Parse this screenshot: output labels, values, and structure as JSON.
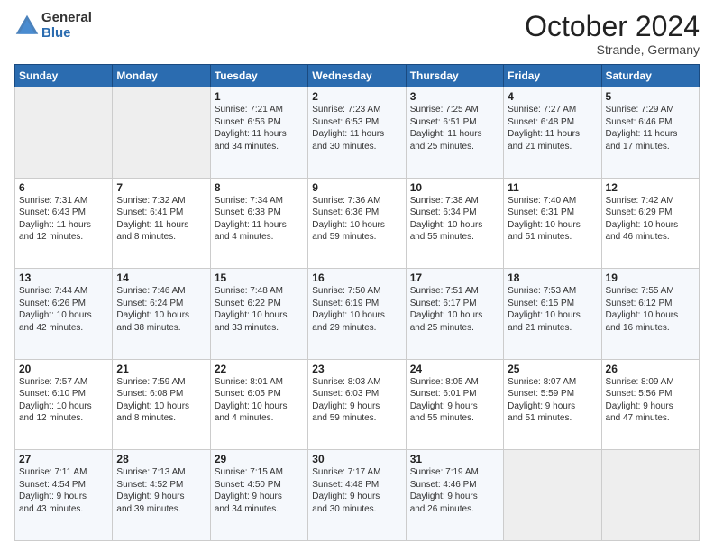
{
  "logo": {
    "general": "General",
    "blue": "Blue"
  },
  "header": {
    "month": "October 2024",
    "location": "Strande, Germany"
  },
  "days_of_week": [
    "Sunday",
    "Monday",
    "Tuesday",
    "Wednesday",
    "Thursday",
    "Friday",
    "Saturday"
  ],
  "weeks": [
    [
      {
        "day": "",
        "content": ""
      },
      {
        "day": "",
        "content": ""
      },
      {
        "day": "1",
        "content": "Sunrise: 7:21 AM\nSunset: 6:56 PM\nDaylight: 11 hours\nand 34 minutes."
      },
      {
        "day": "2",
        "content": "Sunrise: 7:23 AM\nSunset: 6:53 PM\nDaylight: 11 hours\nand 30 minutes."
      },
      {
        "day": "3",
        "content": "Sunrise: 7:25 AM\nSunset: 6:51 PM\nDaylight: 11 hours\nand 25 minutes."
      },
      {
        "day": "4",
        "content": "Sunrise: 7:27 AM\nSunset: 6:48 PM\nDaylight: 11 hours\nand 21 minutes."
      },
      {
        "day": "5",
        "content": "Sunrise: 7:29 AM\nSunset: 6:46 PM\nDaylight: 11 hours\nand 17 minutes."
      }
    ],
    [
      {
        "day": "6",
        "content": "Sunrise: 7:31 AM\nSunset: 6:43 PM\nDaylight: 11 hours\nand 12 minutes."
      },
      {
        "day": "7",
        "content": "Sunrise: 7:32 AM\nSunset: 6:41 PM\nDaylight: 11 hours\nand 8 minutes."
      },
      {
        "day": "8",
        "content": "Sunrise: 7:34 AM\nSunset: 6:38 PM\nDaylight: 11 hours\nand 4 minutes."
      },
      {
        "day": "9",
        "content": "Sunrise: 7:36 AM\nSunset: 6:36 PM\nDaylight: 10 hours\nand 59 minutes."
      },
      {
        "day": "10",
        "content": "Sunrise: 7:38 AM\nSunset: 6:34 PM\nDaylight: 10 hours\nand 55 minutes."
      },
      {
        "day": "11",
        "content": "Sunrise: 7:40 AM\nSunset: 6:31 PM\nDaylight: 10 hours\nand 51 minutes."
      },
      {
        "day": "12",
        "content": "Sunrise: 7:42 AM\nSunset: 6:29 PM\nDaylight: 10 hours\nand 46 minutes."
      }
    ],
    [
      {
        "day": "13",
        "content": "Sunrise: 7:44 AM\nSunset: 6:26 PM\nDaylight: 10 hours\nand 42 minutes."
      },
      {
        "day": "14",
        "content": "Sunrise: 7:46 AM\nSunset: 6:24 PM\nDaylight: 10 hours\nand 38 minutes."
      },
      {
        "day": "15",
        "content": "Sunrise: 7:48 AM\nSunset: 6:22 PM\nDaylight: 10 hours\nand 33 minutes."
      },
      {
        "day": "16",
        "content": "Sunrise: 7:50 AM\nSunset: 6:19 PM\nDaylight: 10 hours\nand 29 minutes."
      },
      {
        "day": "17",
        "content": "Sunrise: 7:51 AM\nSunset: 6:17 PM\nDaylight: 10 hours\nand 25 minutes."
      },
      {
        "day": "18",
        "content": "Sunrise: 7:53 AM\nSunset: 6:15 PM\nDaylight: 10 hours\nand 21 minutes."
      },
      {
        "day": "19",
        "content": "Sunrise: 7:55 AM\nSunset: 6:12 PM\nDaylight: 10 hours\nand 16 minutes."
      }
    ],
    [
      {
        "day": "20",
        "content": "Sunrise: 7:57 AM\nSunset: 6:10 PM\nDaylight: 10 hours\nand 12 minutes."
      },
      {
        "day": "21",
        "content": "Sunrise: 7:59 AM\nSunset: 6:08 PM\nDaylight: 10 hours\nand 8 minutes."
      },
      {
        "day": "22",
        "content": "Sunrise: 8:01 AM\nSunset: 6:05 PM\nDaylight: 10 hours\nand 4 minutes."
      },
      {
        "day": "23",
        "content": "Sunrise: 8:03 AM\nSunset: 6:03 PM\nDaylight: 9 hours\nand 59 minutes."
      },
      {
        "day": "24",
        "content": "Sunrise: 8:05 AM\nSunset: 6:01 PM\nDaylight: 9 hours\nand 55 minutes."
      },
      {
        "day": "25",
        "content": "Sunrise: 8:07 AM\nSunset: 5:59 PM\nDaylight: 9 hours\nand 51 minutes."
      },
      {
        "day": "26",
        "content": "Sunrise: 8:09 AM\nSunset: 5:56 PM\nDaylight: 9 hours\nand 47 minutes."
      }
    ],
    [
      {
        "day": "27",
        "content": "Sunrise: 7:11 AM\nSunset: 4:54 PM\nDaylight: 9 hours\nand 43 minutes."
      },
      {
        "day": "28",
        "content": "Sunrise: 7:13 AM\nSunset: 4:52 PM\nDaylight: 9 hours\nand 39 minutes."
      },
      {
        "day": "29",
        "content": "Sunrise: 7:15 AM\nSunset: 4:50 PM\nDaylight: 9 hours\nand 34 minutes."
      },
      {
        "day": "30",
        "content": "Sunrise: 7:17 AM\nSunset: 4:48 PM\nDaylight: 9 hours\nand 30 minutes."
      },
      {
        "day": "31",
        "content": "Sunrise: 7:19 AM\nSunset: 4:46 PM\nDaylight: 9 hours\nand 26 minutes."
      },
      {
        "day": "",
        "content": ""
      },
      {
        "day": "",
        "content": ""
      }
    ]
  ]
}
